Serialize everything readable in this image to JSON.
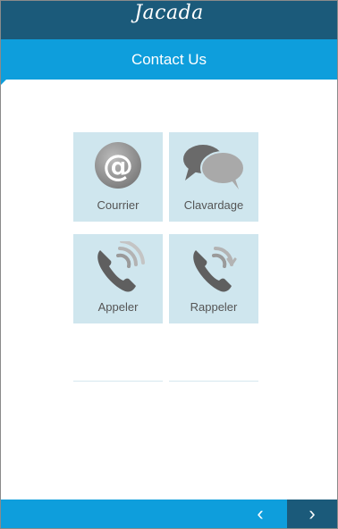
{
  "header": {
    "logo_text": "Jacada"
  },
  "title": "Contact Us",
  "tiles": [
    {
      "label": "Courrier",
      "icon": "at-sign-icon"
    },
    {
      "label": "Clavardage",
      "icon": "chat-bubbles-icon"
    },
    {
      "label": "Appeler",
      "icon": "phone-call-icon"
    },
    {
      "label": "Rappeler",
      "icon": "phone-callback-icon"
    }
  ],
  "footer": {
    "prev_icon": "chevron-left-icon",
    "next_icon": "chevron-right-icon"
  },
  "colors": {
    "header_dark": "#1b5a7a",
    "accent_blue": "#0e9edc",
    "tile_bg": "#cfe6ee",
    "icon_gray": "#6e6e6e"
  }
}
